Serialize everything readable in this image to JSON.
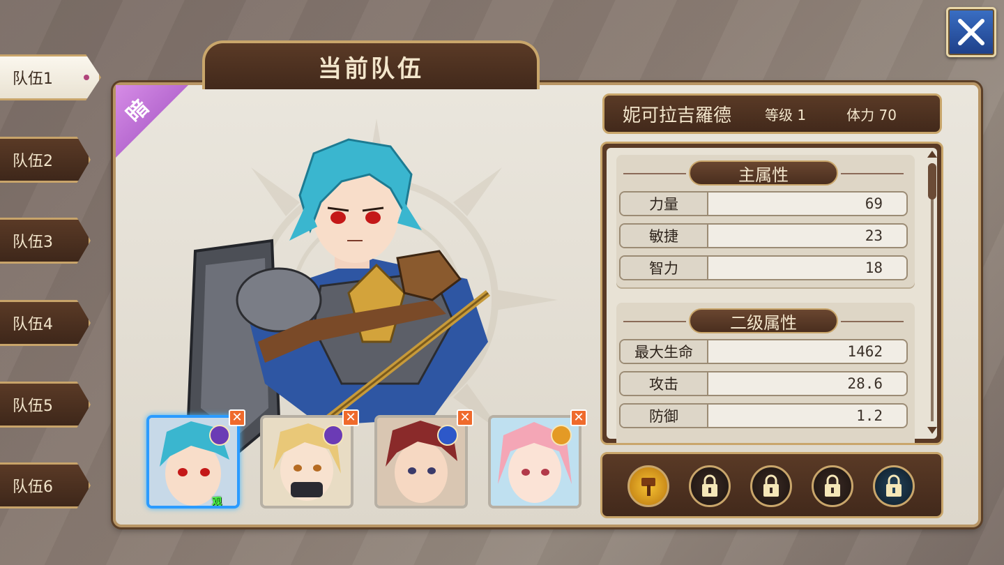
{
  "title": "当前队伍",
  "element_badge": "暗",
  "teams": [
    {
      "label": "队伍1",
      "active": true
    },
    {
      "label": "队伍2",
      "active": false
    },
    {
      "label": "队伍3",
      "active": false
    },
    {
      "label": "队伍4",
      "active": false
    },
    {
      "label": "队伍5",
      "active": false
    },
    {
      "label": "队伍6",
      "active": false
    }
  ],
  "character": {
    "name": "妮可拉吉羅德",
    "level": "等级 1",
    "stamina": "体力  70"
  },
  "primary_stats": {
    "header": "主属性",
    "rows": [
      {
        "label": "力量",
        "value": "69"
      },
      {
        "label": "敏捷",
        "value": "23"
      },
      {
        "label": "智力",
        "value": "18"
      }
    ]
  },
  "secondary_stats": {
    "header": "二级属性",
    "rows": [
      {
        "label": "最大生命",
        "value": "1462"
      },
      {
        "label": "攻击",
        "value": "28.6"
      },
      {
        "label": "防御",
        "value": "1.2"
      }
    ]
  },
  "skills": [
    {
      "icon": "hammer-skill-icon",
      "locked": false
    },
    {
      "icon": "lock-icon",
      "locked": true
    },
    {
      "icon": "lock-icon",
      "locked": true
    },
    {
      "icon": "lock-icon",
      "locked": true
    },
    {
      "icon": "lock-icon",
      "locked": true
    }
  ],
  "party": [
    {
      "hair": "#3ab6cf",
      "element_color": "#6b3bb5",
      "selected": true,
      "tag": "观"
    },
    {
      "hair": "#e9c878",
      "element_color": "#6b3bb5",
      "selected": false
    },
    {
      "hair": "#8a2a2a",
      "element_color": "#2d58c9",
      "selected": false
    },
    {
      "hair": "#f4a6b6",
      "element_color": "#e49a25",
      "selected": false
    }
  ],
  "colors": {
    "accent_gold": "#c9a66b",
    "panel_brown": "#5a3a26",
    "dark_element": "#b060d0"
  }
}
